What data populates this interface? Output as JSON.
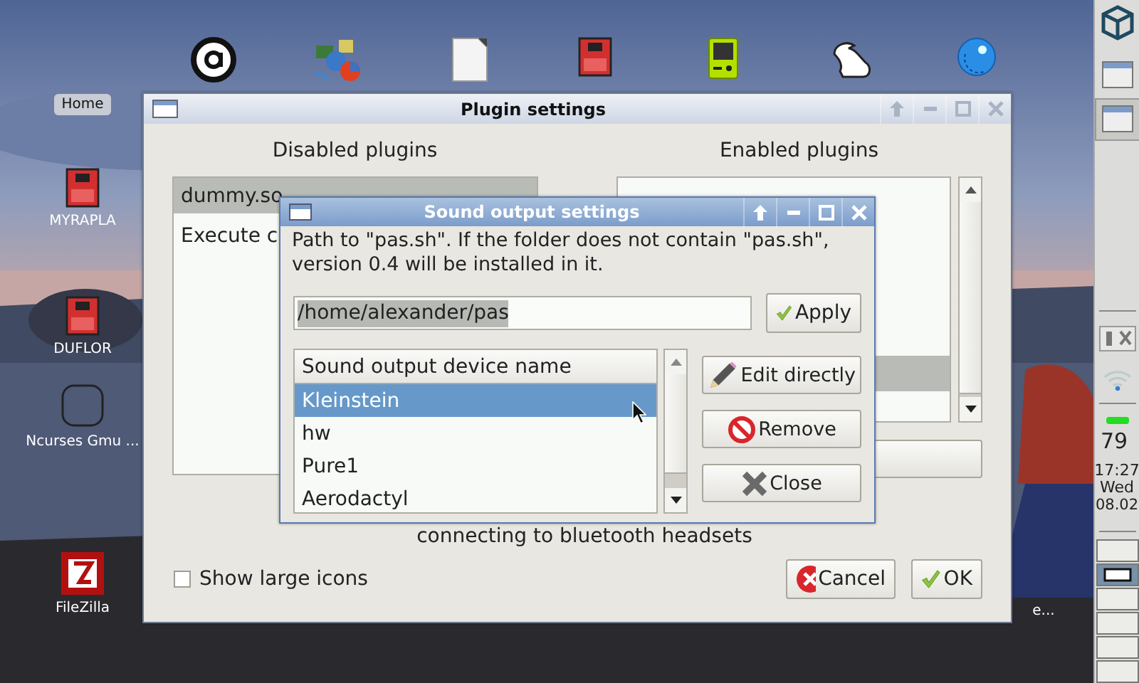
{
  "desktop": {
    "top_icons": [
      {
        "kind": "a-logo"
      },
      {
        "kind": "info"
      },
      {
        "kind": "document"
      },
      {
        "kind": "sdcard"
      },
      {
        "kind": "gameboy"
      },
      {
        "kind": "rabbit"
      },
      {
        "kind": "globe"
      }
    ],
    "side_icons": [
      {
        "kind": "label",
        "label": "Home"
      },
      {
        "kind": "sdcard",
        "label": "MYRAPLA"
      },
      {
        "kind": "sdcard",
        "label": "DUFLOR"
      },
      {
        "kind": "ncurses",
        "label": "Ncurses Gmu ..."
      },
      {
        "kind": "filezilla",
        "label": "FileZilla"
      }
    ],
    "covered_icon_label": "e..."
  },
  "plugin_window": {
    "title": "Plugin settings",
    "title_buttons": [
      {
        "kind": "up"
      },
      {
        "kind": "minimize"
      },
      {
        "kind": "maximize"
      },
      {
        "kind": "close"
      }
    ],
    "disabled_heading": "Disabled plugins",
    "disabled_plugins": [
      {
        "label": "dummy.so",
        "selected": true
      },
      {
        "label": "Execute c",
        "selected": false
      }
    ],
    "enabled_heading": "Enabled plugins",
    "enabled_rows": [
      {
        "selected": false
      },
      {
        "selected": false
      },
      {
        "selected": false
      },
      {
        "selected": false
      },
      {
        "selected": false
      },
      {
        "selected": true
      }
    ],
    "description": "connecting to bluetooth headsets",
    "show_large_icons": {
      "label": "Show large icons",
      "checked": false
    },
    "buttons": [
      {
        "kind": "cancel",
        "label": "Cancel"
      },
      {
        "kind": "ok",
        "label": "OK"
      }
    ]
  },
  "sound_dialog": {
    "title": "Sound output settings",
    "title_buttons": [
      {
        "kind": "up"
      },
      {
        "kind": "minimize"
      },
      {
        "kind": "maximize"
      },
      {
        "kind": "close"
      }
    ],
    "path_hint": "Path to \"pas.sh\". If the folder does not contain \"pas.sh\", version 0.4 will be installed in it.",
    "path_value": "/home/alexander/pas",
    "apply": {
      "kind": "ok",
      "label": "Apply"
    },
    "column": "Sound output device name",
    "devices": [
      {
        "label": "Kleinstein",
        "selected": true
      },
      {
        "label": "hw",
        "selected": false
      },
      {
        "label": "Pure1",
        "selected": false
      },
      {
        "label": "Aerodactyl",
        "selected": false
      }
    ],
    "buttons": [
      {
        "kind": "edit",
        "label": "Edit directly"
      },
      {
        "kind": "remove",
        "label": "Remove"
      },
      {
        "kind": "close",
        "label": "Close"
      }
    ]
  },
  "panel": {
    "battery": "79",
    "time": "17:27",
    "day": "Wed",
    "date": "08.02",
    "workspaces": [
      {
        "selected": false
      },
      {
        "selected": true
      },
      {
        "selected": false
      },
      {
        "selected": false
      },
      {
        "selected": false
      },
      {
        "selected": false
      }
    ]
  }
}
